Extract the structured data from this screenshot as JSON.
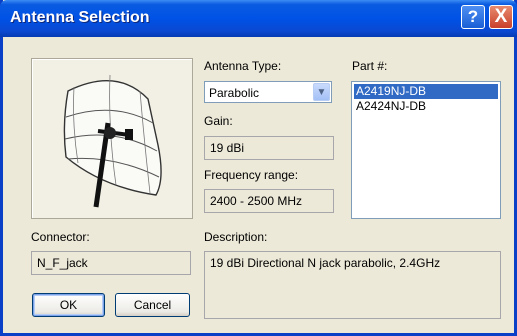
{
  "window": {
    "title": "Antenna Selection"
  },
  "titlebar": {
    "help_glyph": "?",
    "close_glyph": "X"
  },
  "antenna_type": {
    "label": "Antenna Type:",
    "value": "Parabolic"
  },
  "gain": {
    "label": "Gain:",
    "value": "19 dBi"
  },
  "frequency": {
    "label": "Frequency range:",
    "value": "2400 - 2500 MHz"
  },
  "part": {
    "label": "Part #:",
    "items": [
      "A2419NJ-DB",
      "A2424NJ-DB"
    ],
    "selected_index": 0
  },
  "connector": {
    "label": "Connector:",
    "value": "N_F_jack"
  },
  "description": {
    "label": "Description:",
    "value": "19 dBi Directional N jack parabolic, 2.4GHz"
  },
  "buttons": {
    "ok": "OK",
    "cancel": "Cancel"
  },
  "colors": {
    "titlebar": "#0052e6",
    "window_bg": "#ece9d8",
    "selection": "#316ac5"
  },
  "icons": {
    "help": "help-icon",
    "close": "close-icon",
    "dropdown": "chevron-down-icon"
  }
}
